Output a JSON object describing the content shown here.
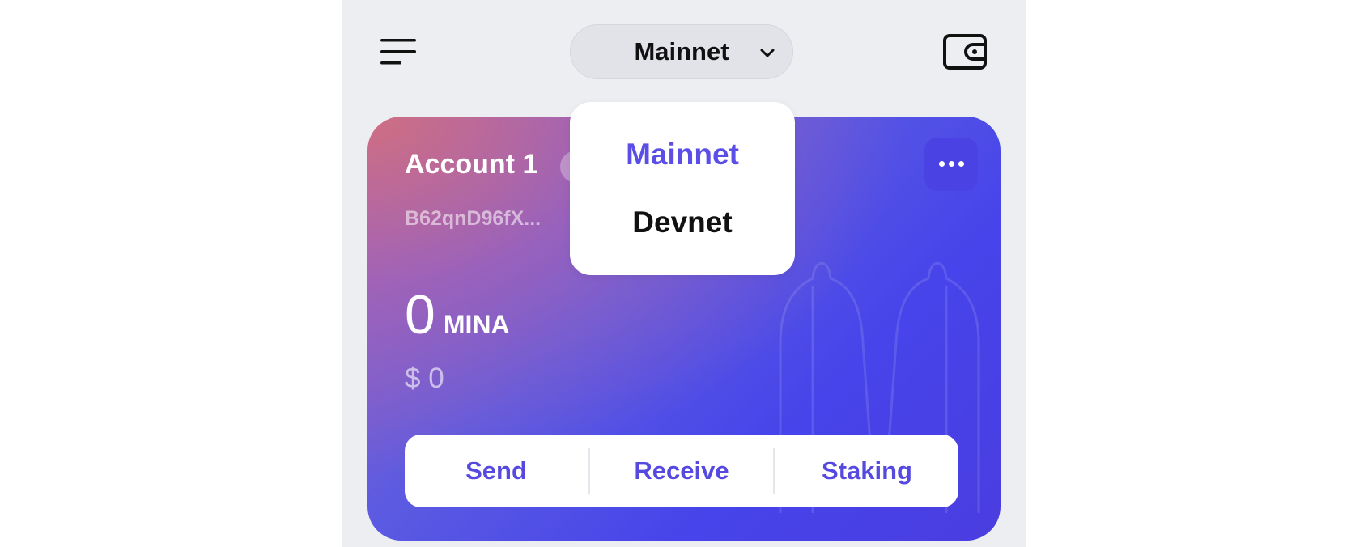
{
  "header": {
    "network": {
      "selected": "Mainnet"
    }
  },
  "network_menu": {
    "options": [
      "Mainnet",
      "Devnet"
    ],
    "active": "Mainnet"
  },
  "account": {
    "name": "Account 1",
    "address": "B62qnD96fX...",
    "balance": "0",
    "unit": "MINA",
    "fiat": "$ 0"
  },
  "actions": {
    "send": "Send",
    "receive": "Receive",
    "staking": "Staking"
  },
  "colors": {
    "accent": "#5549e0",
    "card_start": "#ce6e82",
    "card_end": "#4644ea",
    "panel_bg": "#edeef2"
  }
}
